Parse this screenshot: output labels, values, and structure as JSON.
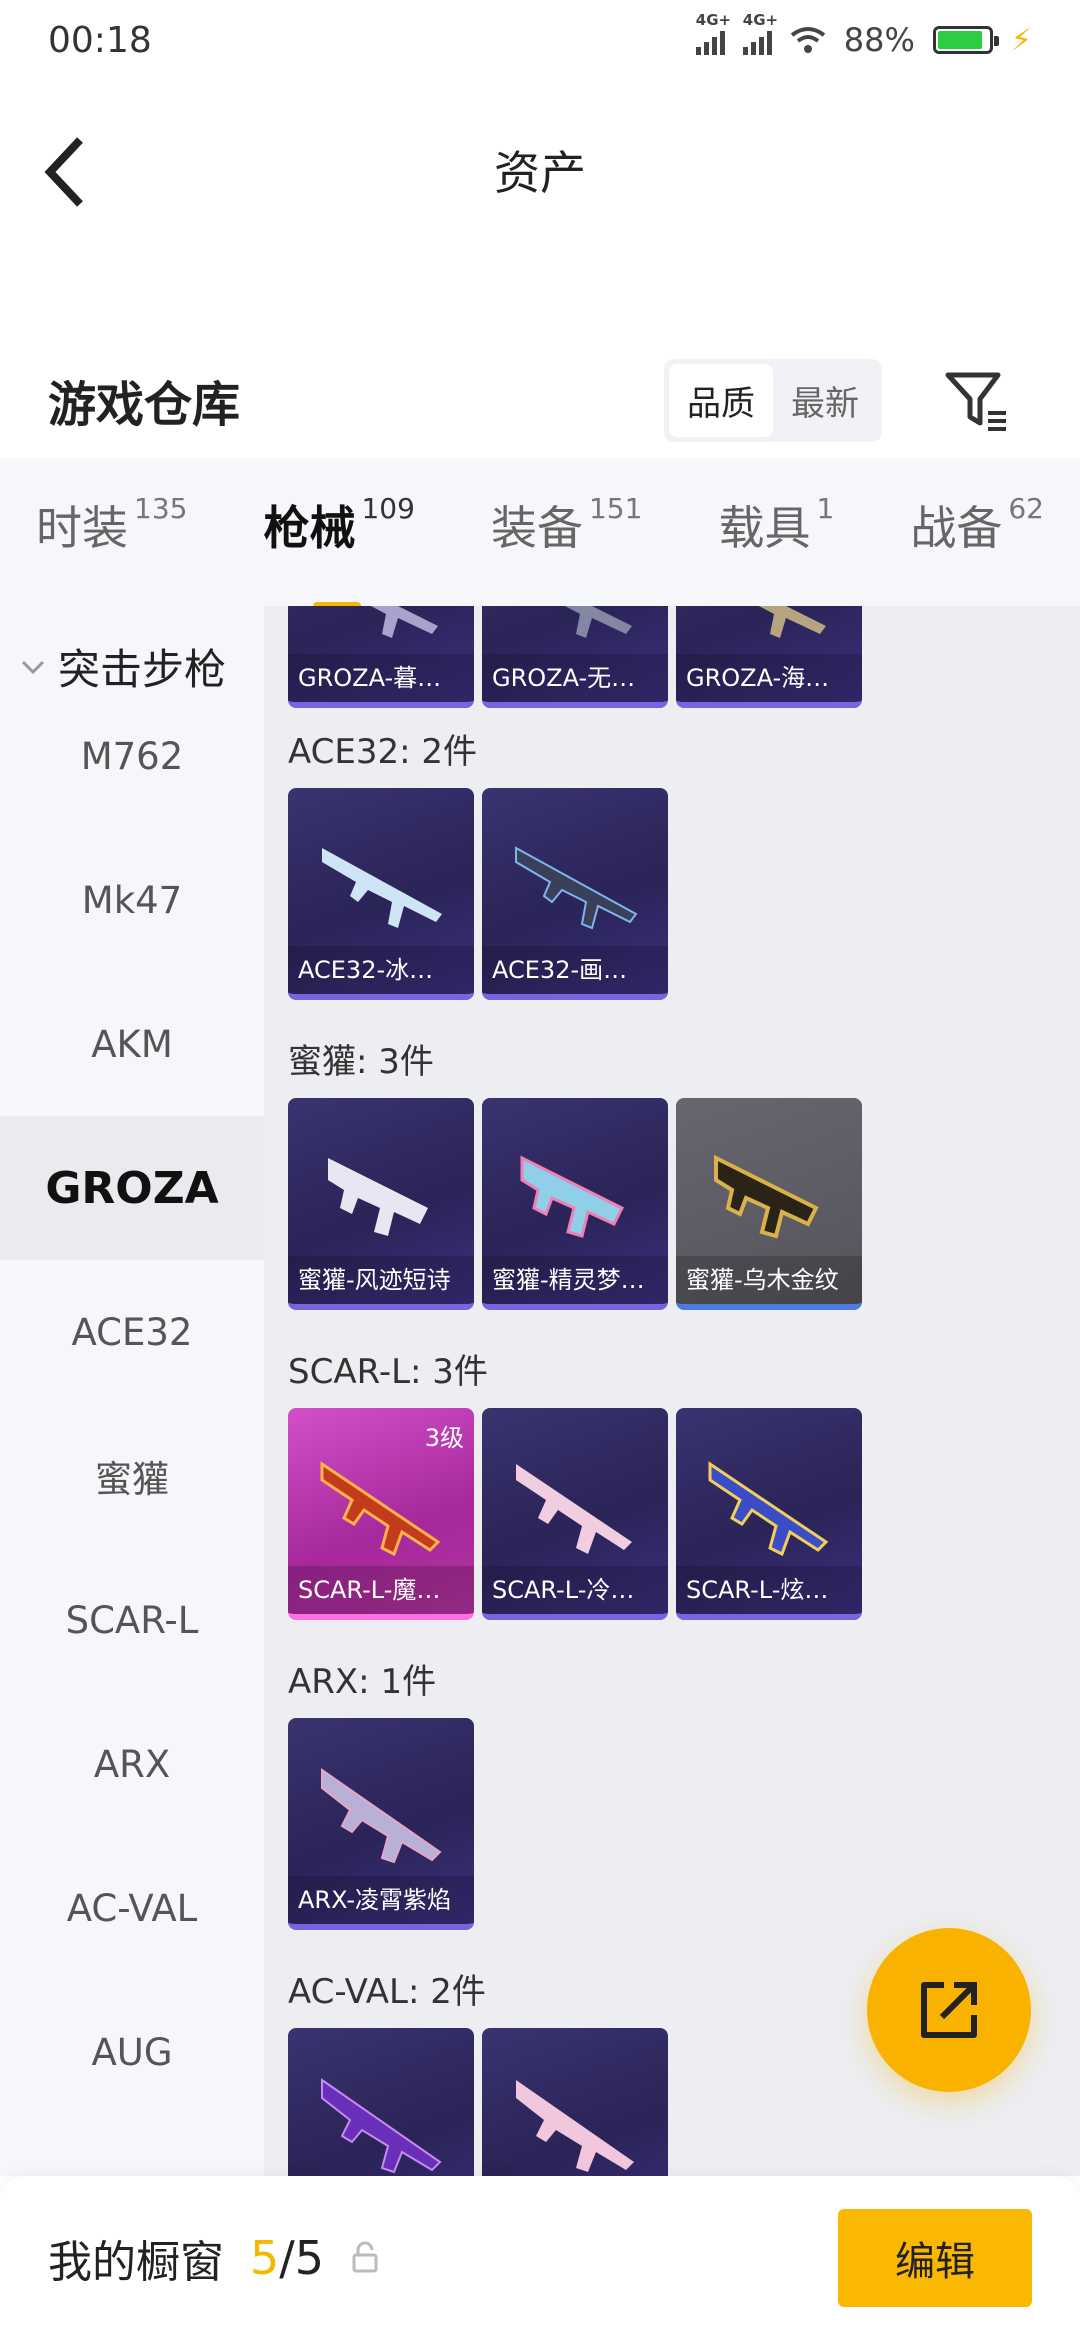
{
  "status_bar": {
    "time": "00:18",
    "network_1": "4G+",
    "network_2": "4G+",
    "battery_percent": "88%",
    "battery_level": 0.88
  },
  "header": {
    "title": "资产"
  },
  "warehouse": {
    "title": "游戏仓库",
    "sort_options": [
      "品质",
      "最新"
    ],
    "sort_selected": "品质"
  },
  "tabs": [
    {
      "label": "时装",
      "count": "135"
    },
    {
      "label": "枪械",
      "count": "109",
      "active": true
    },
    {
      "label": "装备",
      "count": "151"
    },
    {
      "label": "载具",
      "count": "1"
    },
    {
      "label": "战备",
      "count": "62"
    }
  ],
  "sidebar": {
    "group_label": "突击步枪",
    "items": [
      "M762",
      "Mk47",
      "AKM",
      "GROZA",
      "ACE32",
      "蜜獾",
      "SCAR-L",
      "ARX",
      "AC-VAL",
      "AUG"
    ],
    "active": "GROZA"
  },
  "sections": [
    {
      "title": "",
      "cards": [
        "GROZA-暮…",
        "GROZA-无…",
        "GROZA-海…"
      ]
    },
    {
      "title": "ACE32: 2件",
      "cards": [
        "ACE32-冰…",
        "ACE32-画…"
      ]
    },
    {
      "title": "蜜獾: 3件",
      "cards": [
        "蜜獾-风迹短诗",
        "蜜獾-精灵梦…",
        "蜜獾-乌木金纹"
      ]
    },
    {
      "title": "SCAR-L: 3件",
      "cards": [
        "SCAR-L-魔…",
        "SCAR-L-冷…",
        "SCAR-L-炫…"
      ],
      "first_card_level": "3级"
    },
    {
      "title": "ARX: 1件",
      "cards": [
        "ARX-凌霄紫焰"
      ]
    },
    {
      "title": "AC-VAL: 2件",
      "cards": [
        "",
        ""
      ]
    }
  ],
  "bottom_bar": {
    "label": "我的橱窗",
    "count_current": "5",
    "count_separator": "/",
    "count_max": "5",
    "edit_label": "编辑"
  },
  "colors": {
    "accent": "#f5b800",
    "card_purple": "#2a2457",
    "card_pink": "#a6289b",
    "card_gray": "#55545b"
  }
}
